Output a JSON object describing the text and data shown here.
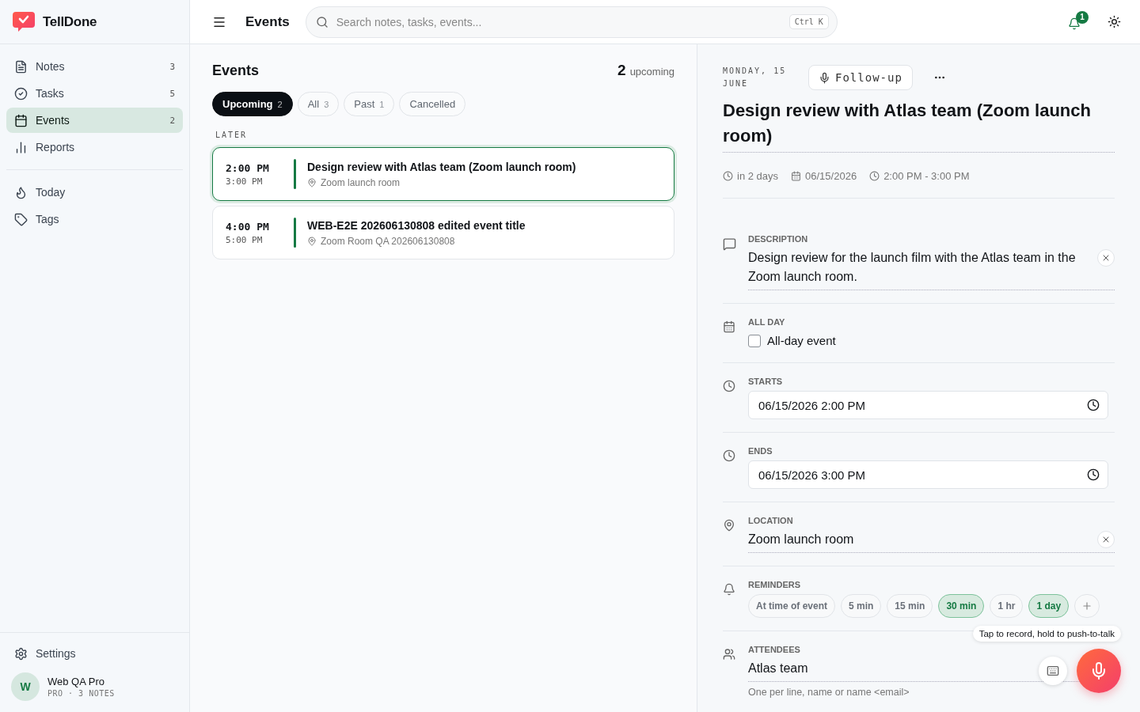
{
  "app": {
    "name": "TellDone"
  },
  "sidebar": {
    "nav": [
      {
        "label": "Notes",
        "count": "3",
        "selected": false
      },
      {
        "label": "Tasks",
        "count": "5",
        "selected": false
      },
      {
        "label": "Events",
        "count": "2",
        "selected": true
      },
      {
        "label": "Reports",
        "selected": false
      }
    ],
    "secondary": [
      {
        "label": "Today",
        "selected": false
      },
      {
        "label": "Tags",
        "selected": false
      }
    ],
    "settings": "Settings",
    "user": {
      "initial": "W",
      "name": "Web QA Pro",
      "meta": "PRO · 3 NOTES"
    }
  },
  "topbar": {
    "title": "Events",
    "search_placeholder": "Search notes, tasks, events...",
    "shortcut": "Ctrl K",
    "notification_count": "1"
  },
  "list": {
    "title": "Events",
    "upcoming_count": "2",
    "upcoming_label": "upcoming",
    "filters": [
      {
        "label": "Upcoming",
        "count": "2",
        "selected": true
      },
      {
        "label": "All",
        "count": "3",
        "selected": false
      },
      {
        "label": "Past",
        "count": "1",
        "selected": false
      },
      {
        "label": "Cancelled",
        "selected": false
      }
    ],
    "group": "LATER",
    "events": [
      {
        "start": "2:00 PM",
        "end": "3:00 PM",
        "title": "Design review with Atlas team (Zoom launch room)",
        "location": "Zoom launch room",
        "selected": true
      },
      {
        "start": "4:00 PM",
        "end": "5:00 PM",
        "title": "WEB-E2E 202606130808 edited event title",
        "location": "Zoom Room QA 202606130808",
        "selected": false
      }
    ]
  },
  "detail": {
    "date": "MONDAY, 15 JUNE",
    "follow_up": "Follow-up",
    "title": "Design review with Atlas team (Zoom launch room)",
    "meta": {
      "relative": "in 2 days",
      "date": "06/15/2026",
      "time": "2:00 PM - 3:00 PM"
    },
    "fields": [
      {
        "kind": "text",
        "label": "DESCRIPTION",
        "value": "Design review for the launch film with the Atlas team in the Zoom launch room."
      },
      {
        "kind": "checkbox",
        "label": "ALL DAY",
        "option": "All-day event",
        "checked": false
      },
      {
        "kind": "datetime",
        "label": "STARTS",
        "value": "06/15/2026 2:00 PM"
      },
      {
        "kind": "datetime",
        "label": "ENDS",
        "value": "06/15/2026 3:00 PM"
      },
      {
        "kind": "text",
        "label": "LOCATION",
        "value": "Zoom launch room"
      },
      {
        "kind": "chips",
        "label": "REMINDERS",
        "chips": [
          {
            "label": "At time of event",
            "selected": false
          },
          {
            "label": "5 min",
            "selected": false
          },
          {
            "label": "15 min",
            "selected": false
          },
          {
            "label": "30 min",
            "selected": true
          },
          {
            "label": "1 hr",
            "selected": false
          },
          {
            "label": "1 day",
            "selected": true
          }
        ]
      },
      {
        "kind": "multiline",
        "label": "ATTENDEES",
        "value": "Atlas team",
        "hint": "One per line, name or name <email>"
      }
    ]
  },
  "voice": {
    "tooltip": "Tap to record, hold to push-to-talk"
  }
}
